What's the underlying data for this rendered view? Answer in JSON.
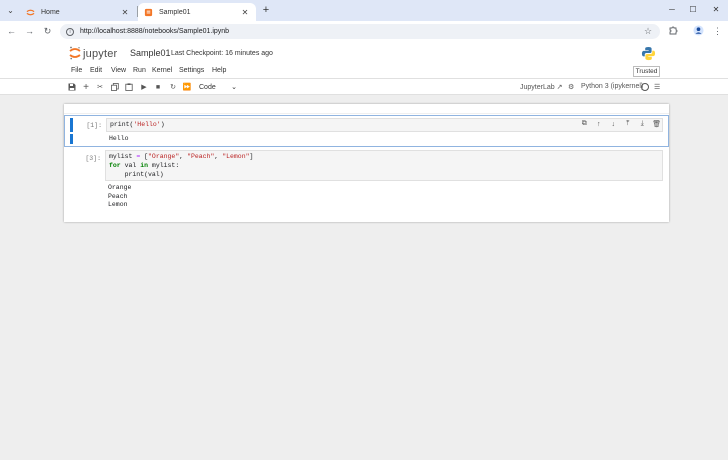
{
  "browser": {
    "tabs": [
      {
        "title": "Home"
      },
      {
        "title": "Sample01"
      }
    ],
    "url": "http://localhost:8888/notebooks/Sample01.ipynb"
  },
  "jupyter": {
    "wordmark": "jupyter",
    "notebook_name": "Sample01",
    "checkpoint": "Last Checkpoint: 16 minutes ago",
    "menu": [
      "File",
      "Edit",
      "View",
      "Run",
      "Kernel",
      "Settings",
      "Help"
    ],
    "trusted": "Trusted",
    "cell_type": "Code",
    "jupyterlab_label": "JupyterLab",
    "kernel": "Python 3 (ipykernel)",
    "accent_color": "#1976d2",
    "brand_color": "#f37626"
  },
  "cells": [
    {
      "prompt": "[1]:",
      "code": [
        "print('Hello')"
      ],
      "output": "Hello"
    },
    {
      "prompt": "[3]:",
      "code": [
        "mylist = [\"Orange\", \"Peach\", \"Lemon\"]",
        "for val in mylist:",
        "    print(val)"
      ],
      "output_lines": [
        "Orange",
        "Peach",
        "Lemon"
      ]
    }
  ]
}
